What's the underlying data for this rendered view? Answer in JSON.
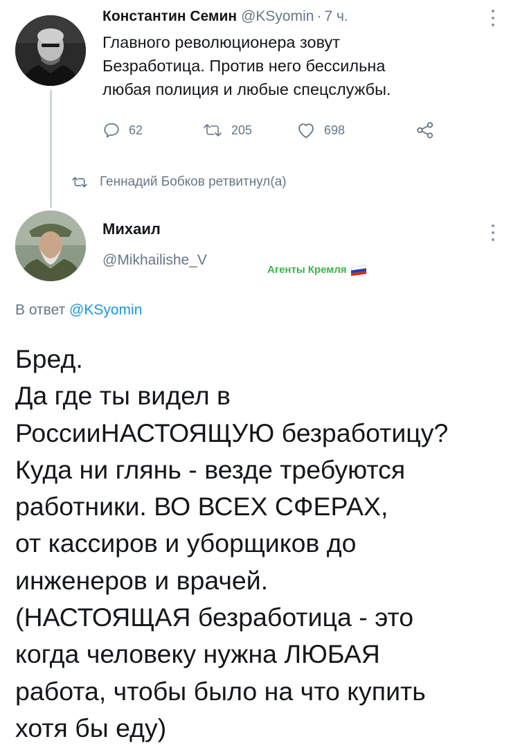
{
  "tweet_1": {
    "author_name": "Константин Семин",
    "author_handle": "@KSyomin",
    "separator": "·",
    "time": "7 ч.",
    "text_lines": [
      "Главного революционера зовут",
      "Безработица. Против него бессильна",
      "любая полиция и любые спецслужбы."
    ],
    "actions": {
      "reply_count": "62",
      "retweet_count": "205",
      "like_count": "698"
    }
  },
  "retweet_notice": "Геннадий Бобков ретвитнул(а)",
  "tweet_2": {
    "author_name": "Михаил",
    "author_handle": "@Mikhailishe_V",
    "badge": "Агенты Кремля",
    "reply_to_prefix": "В ответ",
    "reply_to_handle": "@KSyomin",
    "text_lines": [
      "Бред.",
      "Да где ты видел в",
      "РоссииНАСТОЯЩУЮ безработицу?",
      "Куда ни глянь - везде требуются",
      "работники. ВО ВСЕХ СФЕРАХ,",
      "от кассиров и уборщиков до",
      "инженеров и врачей.",
      "(НАСТОЯЩАЯ безработица - это",
      "когда человеку нужна ЛЮБАЯ",
      "работа, чтобы было на что купить",
      "хотя бы еду)"
    ]
  },
  "colors": {
    "text": "#14171a",
    "muted": "#657786",
    "link": "#1b95e0",
    "badge": "#3bb54a",
    "thread_line": "#ccd6dd"
  },
  "icons": [
    "reply-icon",
    "retweet-icon",
    "like-icon",
    "share-icon",
    "more-icon",
    "russian-flag-icon"
  ]
}
